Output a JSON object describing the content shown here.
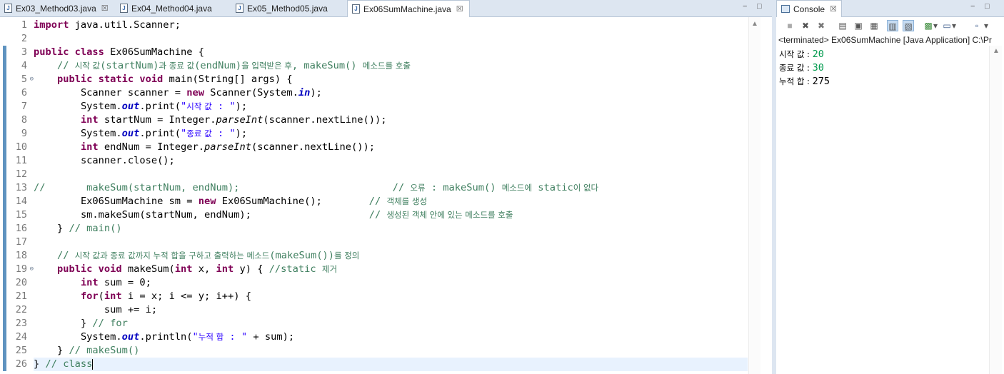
{
  "editor": {
    "tabs": [
      {
        "label": "Ex03_Method03.java",
        "close": "☒"
      },
      {
        "label": "Ex04_Method04.java"
      },
      {
        "label": "Ex05_Method05.java"
      },
      {
        "label": "Ex06SumMachine.java",
        "close": "☒"
      }
    ],
    "file_icon_letter": "J",
    "window_buttons": {
      "minimize": "−",
      "maximize": "□"
    },
    "line_numbers": [
      "1",
      "2",
      "3",
      "4",
      "5",
      "6",
      "7",
      "8",
      "9",
      "10",
      "11",
      "12",
      "13",
      "14",
      "15",
      "16",
      "17",
      "18",
      "19",
      "20",
      "21",
      "22",
      "23",
      "24",
      "25",
      "26"
    ],
    "fold_markers": {
      "line5": "⊖",
      "line19": "⊖"
    },
    "scroll_arrow": "▲",
    "code": {
      "l1_kw": "import",
      "l1_rest": " java.util.Scanner;",
      "l3_kw": "public class",
      "l3_rest": " Ex06SumMachine {",
      "l4_a": "// ",
      "l4_b": "시작 값",
      "l4_c": "(startNum)",
      "l4_d": "과 종료 값",
      "l4_e": "(endNum)",
      "l4_f": "을 입력받은 후",
      "l4_g": ", makeSum() ",
      "l4_h": "메소드를 호출",
      "l5_kw": "public static void",
      "l5_rest": " main(String[] args) {",
      "l6_a": "Scanner scanner = ",
      "l6_kw": "new",
      "l6_b": " Scanner(System.",
      "l6_fs": "in",
      "l6_c": ");",
      "l7_a": "System.",
      "l7_fs": "out",
      "l7_b": ".print(",
      "l7_s1": "\"",
      "l7_s2": "시작 값",
      "l7_s3": " : \"",
      "l7_c": ");",
      "l8_kw": "int",
      "l8_a": " startNum = Integer.",
      "l8_m": "parseInt",
      "l8_b": "(scanner.nextLine());",
      "l9_a": "System.",
      "l9_fs": "out",
      "l9_b": ".print(",
      "l9_s1": "\"",
      "l9_s2": "종료 값",
      "l9_s3": " : \"",
      "l9_c": ");",
      "l10_kw": "int",
      "l10_a": " endNum = Integer.",
      "l10_m": "parseInt",
      "l10_b": "(scanner.nextLine());",
      "l11": "scanner.close();",
      "l13_a": "//       makeSum(startNum, endNum);                          // ",
      "l13_b": "오류",
      "l13_c": " : makeSum() ",
      "l13_d": "메소드에",
      "l13_e": " static",
      "l13_f": "이 없다",
      "l14_a": "Ex06SumMachine sm = ",
      "l14_kw": "new",
      "l14_b": " Ex06SumMachine();        ",
      "l14_c": "// ",
      "l14_d": "객체를 생성",
      "l15_a": "sm.makeSum(startNum, endNum);                    ",
      "l15_c": "// ",
      "l15_d": "생성된 객체 안에 있는 메소드를 호출",
      "l16_a": "} ",
      "l16_c": "// main()",
      "l18_a": "// ",
      "l18_b": "시작 값과 종료 값까지 누적 합을 구하고 출력하는 메소드",
      "l18_c": "(makeSum())",
      "l18_d": "를 정의",
      "l19_kw": "public void",
      "l19_a": " makeSum(",
      "l19_kw2": "int",
      "l19_b": " x, ",
      "l19_kw3": "int",
      "l19_c": " y) { ",
      "l19_cm1": "//static ",
      "l19_cm2": "제거",
      "l20_kw": "int",
      "l20_a": " sum = 0;",
      "l21_kw": "for",
      "l21_a": "(",
      "l21_kw2": "int",
      "l21_b": " i = x; i <= y; i++) {",
      "l22": "sum += i;",
      "l23_a": "} ",
      "l23_c": "// for",
      "l24_a": "System.",
      "l24_fs": "out",
      "l24_b": ".println(",
      "l24_s1": "\"",
      "l24_s2": "누적 합",
      "l24_s3": " : \"",
      "l24_c": " + sum);",
      "l25_a": "} ",
      "l25_c": "// makeSum()",
      "l26_a": "} ",
      "l26_c": "// class"
    }
  },
  "console": {
    "tab_label": "Console",
    "tab_close": "☒",
    "window_buttons": {
      "minimize": "−",
      "maximize": "□"
    },
    "toolbar_icons": [
      "■",
      "✖",
      "✖",
      "▤",
      "▣",
      "▦",
      "▥",
      "▧",
      "▩",
      "▾",
      "▭",
      "▾",
      "▫",
      "▾"
    ],
    "status": "<terminated> Ex06SumMachine [Java Application] C:\\Pr",
    "output": [
      {
        "label": "시작 값 : ",
        "value": "20",
        "is_input": true
      },
      {
        "label": "종료 값 : ",
        "value": "30",
        "is_input": true
      },
      {
        "label": "누적 합 : ",
        "value": "275",
        "is_input": false
      }
    ],
    "scroll_arrow": "▲"
  },
  "colors": {
    "keyword": "#7f0055",
    "comment": "#3f7f5f",
    "string": "#2a00ff",
    "static_field": "#0000c0",
    "console_input": "#009a4d",
    "current_line": "#e8f2fe",
    "tab_bar": "#dde6f1"
  }
}
